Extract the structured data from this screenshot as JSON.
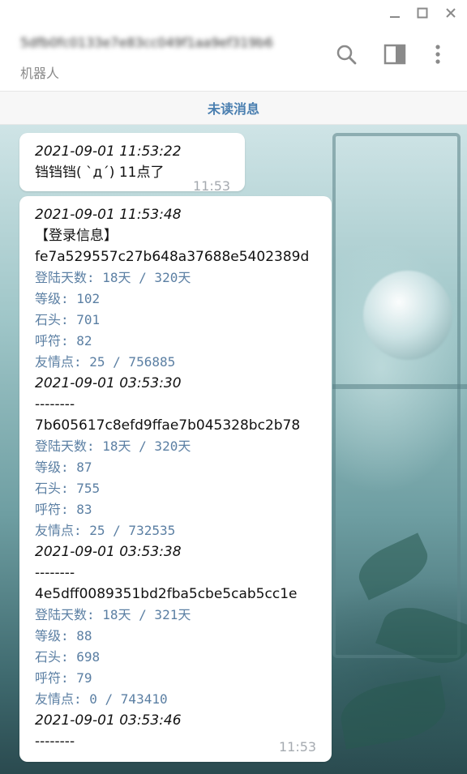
{
  "window": {
    "minimize_icon": "minimize-icon",
    "maximize_icon": "maximize-icon",
    "close_icon": "close-icon"
  },
  "header": {
    "title": "5dfb0fc0133e7e83cc049f1aa9ef319b6",
    "subtitle": "机器人",
    "icons": [
      "search-icon",
      "sidebar-toggle-icon",
      "more-vertical-icon"
    ]
  },
  "unread_label": "未读消息",
  "messages": [
    {
      "lines": [
        {
          "kind": "ts",
          "text": "2021-09-01 11:53:22"
        },
        {
          "kind": "txt",
          "text": "铛铛铛( `д´) 11点了"
        }
      ],
      "time": "11:53"
    },
    {
      "lines": [
        {
          "kind": "ts",
          "text": "2021-09-01 11:53:48"
        },
        {
          "kind": "txt",
          "text": "【登录信息】"
        },
        {
          "kind": "hash",
          "text": "fe7a529557c27b648a37688e5402389d"
        },
        {
          "kind": "stat",
          "text": "登陆天数: 18天 / 320天"
        },
        {
          "kind": "stat",
          "text": "等级: 102"
        },
        {
          "kind": "stat",
          "text": "石头: 701"
        },
        {
          "kind": "stat",
          "text": "呼符: 82"
        },
        {
          "kind": "stat",
          "text": "友情点: 25 / 756885"
        },
        {
          "kind": "ts",
          "text": "2021-09-01 03:53:30"
        },
        {
          "kind": "txt",
          "text": "--------"
        },
        {
          "kind": "hash",
          "text": "7b605617c8efd9ffae7b045328bc2b78"
        },
        {
          "kind": "stat",
          "text": "登陆天数: 18天 / 320天"
        },
        {
          "kind": "stat",
          "text": "等级: 87"
        },
        {
          "kind": "stat",
          "text": "石头: 755"
        },
        {
          "kind": "stat",
          "text": "呼符: 83"
        },
        {
          "kind": "stat",
          "text": "友情点: 25 / 732535"
        },
        {
          "kind": "ts",
          "text": "2021-09-01 03:53:38"
        },
        {
          "kind": "txt",
          "text": "--------"
        },
        {
          "kind": "hash",
          "text": "4e5dff0089351bd2fba5cbe5cab5cc1e"
        },
        {
          "kind": "stat",
          "text": "登陆天数: 18天 / 321天"
        },
        {
          "kind": "stat",
          "text": "等级: 88"
        },
        {
          "kind": "stat",
          "text": "石头: 698"
        },
        {
          "kind": "stat",
          "text": "呼符: 79"
        },
        {
          "kind": "stat",
          "text": "友情点: 0 / 743410"
        },
        {
          "kind": "ts",
          "text": "2021-09-01 03:53:46"
        },
        {
          "kind": "txt",
          "text": "--------"
        }
      ],
      "time": "11:53"
    }
  ]
}
